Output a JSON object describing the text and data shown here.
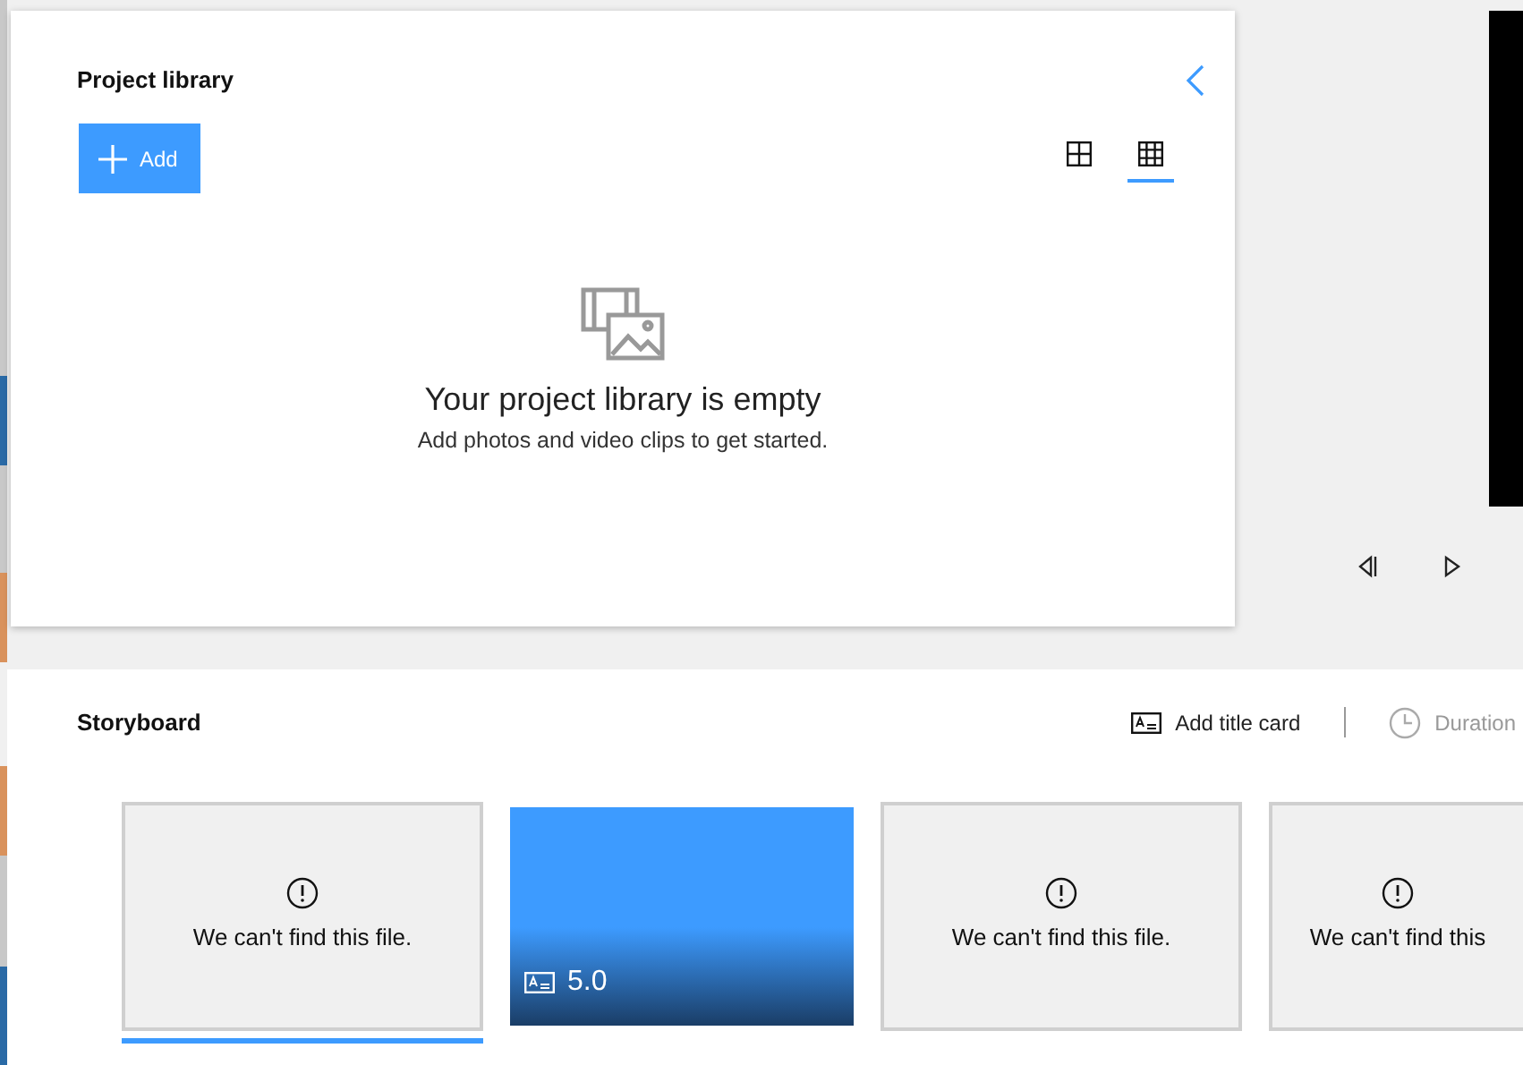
{
  "library": {
    "title": "Project library",
    "add_button": "Add",
    "view_options": [
      {
        "kind": "large",
        "selected": false
      },
      {
        "kind": "small",
        "selected": true
      }
    ],
    "empty_title": "Your project library is empty",
    "empty_subtitle": "Add photos and video clips to get started."
  },
  "storyboard": {
    "title": "Storyboard",
    "add_title_card": "Add title card",
    "duration": "Duration",
    "clips": [
      {
        "kind": "missing",
        "message": "We can't find this file.",
        "selected": true
      },
      {
        "kind": "title",
        "duration": "5.0",
        "selected": false
      },
      {
        "kind": "missing",
        "message": "We can't find this file.",
        "selected": false
      },
      {
        "kind": "missing",
        "message": "We can't find this",
        "selected": false
      }
    ]
  }
}
